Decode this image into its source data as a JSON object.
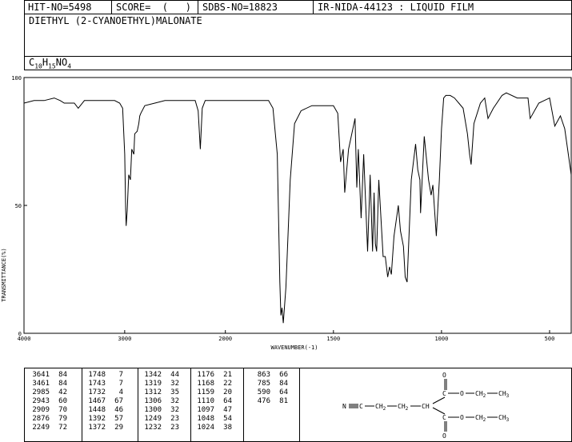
{
  "header": {
    "hit_no": "HIT-NO=5498",
    "score": "SCORE=  (   )",
    "sdbs_no": "SDBS-NO=18823",
    "ir_method": "IR-NIDA-44123 : LIQUID FILM",
    "compound_name": "DIETHYL (2-CYANOETHYL)MALONATE",
    "formula": {
      "c": "C",
      "c_n": "10",
      "h": "H",
      "h_n": "15",
      "rest": "NO",
      "o_n": "4"
    }
  },
  "chart_data": {
    "type": "line",
    "xlabel": "WAVENUMBER(-1)",
    "ylabel": "TRANSMITTANCE(%)",
    "xlim": [
      4000,
      400
    ],
    "ylim": [
      0,
      100
    ],
    "x_ticks": [
      "4000",
      "3000",
      "2000",
      "1500",
      "1000",
      "500"
    ],
    "y_ticks": [
      "100",
      "50",
      "0"
    ],
    "grid": false,
    "series": [
      {
        "x": [
          4000,
          3900,
          3800,
          3700,
          3641,
          3600,
          3500,
          3461,
          3400,
          3300,
          3200,
          3100,
          3050,
          3020,
          3000,
          2990,
          2985,
          2975,
          2960,
          2943,
          2930,
          2909,
          2900,
          2876,
          2860,
          2850,
          2840,
          2800,
          2700,
          2600,
          2500,
          2400,
          2300,
          2270,
          2249,
          2230,
          2200,
          2100,
          2000,
          1900,
          1850,
          1800,
          1780,
          1760,
          1748,
          1743,
          1738,
          1732,
          1720,
          1700,
          1680,
          1650,
          1600,
          1550,
          1500,
          1480,
          1467,
          1455,
          1448,
          1430,
          1400,
          1392,
          1385,
          1372,
          1360,
          1342,
          1330,
          1319,
          1312,
          1306,
          1300,
          1290,
          1270,
          1260,
          1249,
          1240,
          1232,
          1220,
          1200,
          1190,
          1176,
          1168,
          1159,
          1140,
          1120,
          1110,
          1100,
          1097,
          1080,
          1060,
          1048,
          1040,
          1024,
          1010,
          1000,
          990,
          980,
          960,
          940,
          920,
          900,
          880,
          870,
          863,
          850,
          820,
          800,
          785,
          760,
          720,
          700,
          650,
          600,
          590,
          550,
          500,
          476,
          450,
          430,
          400
        ],
        "y": [
          90,
          91,
          91,
          92,
          91,
          90,
          90,
          88,
          91,
          91,
          91,
          91,
          90,
          88,
          70,
          48,
          42,
          48,
          62,
          60,
          72,
          70,
          78,
          79,
          82,
          85,
          86,
          89,
          90,
          91,
          91,
          91,
          91,
          87,
          72,
          88,
          91,
          91,
          91,
          91,
          91,
          91,
          88,
          70,
          20,
          7,
          10,
          4,
          18,
          60,
          82,
          87,
          89,
          89,
          89,
          86,
          67,
          72,
          55,
          72,
          84,
          57,
          72,
          45,
          70,
          32,
          62,
          32,
          55,
          35,
          32,
          60,
          30,
          30,
          22,
          26,
          23,
          38,
          50,
          40,
          34,
          22,
          20,
          60,
          74,
          64,
          60,
          47,
          77,
          60,
          54,
          58,
          38,
          60,
          80,
          92,
          93,
          93,
          92,
          90,
          88,
          78,
          70,
          66,
          82,
          90,
          92,
          84,
          88,
          93,
          94,
          92,
          92,
          84,
          90,
          92,
          81,
          85,
          80,
          62
        ]
      }
    ]
  },
  "peak_columns": [
    [
      [
        "3641",
        "84"
      ],
      [
        "3461",
        "84"
      ],
      [
        "2985",
        "42"
      ],
      [
        "2943",
        "60"
      ],
      [
        "2909",
        "70"
      ],
      [
        "2876",
        "79"
      ],
      [
        "2249",
        "72"
      ]
    ],
    [
      [
        "1748",
        "7"
      ],
      [
        "1743",
        "7"
      ],
      [
        "1732",
        "4"
      ],
      [
        "1467",
        "67"
      ],
      [
        "1448",
        "46"
      ],
      [
        "1392",
        "57"
      ],
      [
        "1372",
        "29"
      ]
    ],
    [
      [
        "1342",
        "44"
      ],
      [
        "1319",
        "32"
      ],
      [
        "1312",
        "35"
      ],
      [
        "1306",
        "32"
      ],
      [
        "1300",
        "32"
      ],
      [
        "1249",
        "23"
      ],
      [
        "1232",
        "23"
      ]
    ],
    [
      [
        "1176",
        "21"
      ],
      [
        "1168",
        "22"
      ],
      [
        "1159",
        "20"
      ],
      [
        "1110",
        "64"
      ],
      [
        "1097",
        "47"
      ],
      [
        "1048",
        "54"
      ],
      [
        "1024",
        "38"
      ]
    ],
    [
      [
        "863",
        "66"
      ],
      [
        "785",
        "84"
      ],
      [
        "590",
        "64"
      ],
      [
        "476",
        "81"
      ]
    ]
  ],
  "structure": {
    "o_top": "O",
    "o_bottom": "O",
    "n": "N",
    "ch2_a": "CH",
    "ch2_b": "CH",
    "ch": "CH",
    "c_top": "C",
    "c_bottom": "C",
    "o_ester_top": "O",
    "o_ester_bottom": "O",
    "ch2_ester_top": "CH",
    "ch2_ester_bottom": "CH",
    "ch3_top": "CH",
    "ch3_bottom": "CH",
    "c_nitrile": "C",
    "sub2": "2",
    "sub3": "3"
  }
}
